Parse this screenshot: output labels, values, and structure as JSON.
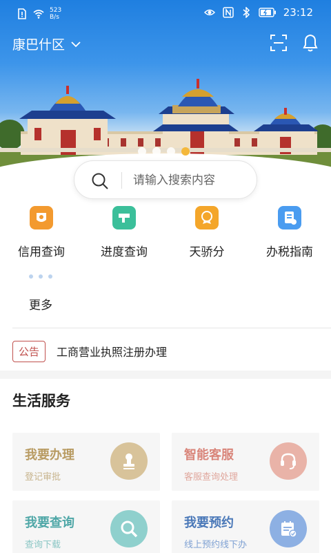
{
  "status_bar": {
    "network_speed_value": "523",
    "network_speed_unit": "B/s",
    "time": "23:12"
  },
  "header": {
    "district": "康巴什区"
  },
  "carousel": {
    "dot_count": 4,
    "active_index": 3
  },
  "search": {
    "placeholder": "请输入搜索内容"
  },
  "quick_services": [
    {
      "label": "信用查询",
      "icon": "credit-icon",
      "color": "#f39a2f"
    },
    {
      "label": "进度查询",
      "icon": "progress-icon",
      "color": "#3bbf9a"
    },
    {
      "label": "天骄分",
      "icon": "score-icon",
      "color": "#f4a62a"
    },
    {
      "label": "办税指南",
      "icon": "tax-guide-icon",
      "color": "#4a9cf0"
    }
  ],
  "more": {
    "label": "更多"
  },
  "notice": {
    "tag": "公告",
    "text": "工商营业执照注册办理"
  },
  "life_services": {
    "title": "生活服务",
    "cards": [
      {
        "title": "我要办理",
        "subtitle": "登记审批",
        "icon": "stamp-icon",
        "color": "#b89b62",
        "icon_bg": "#d8c39a"
      },
      {
        "title": "智能客服",
        "subtitle": "客服查询处理",
        "icon": "headset-icon",
        "color": "#d9857a",
        "icon_bg": "#e9b3a8"
      },
      {
        "title": "我要查询",
        "subtitle": "查询下载",
        "icon": "search-icon",
        "color": "#4fa7a7",
        "icon_bg": "#8fd0cd"
      },
      {
        "title": "我要预约",
        "subtitle": "线上预约线下办",
        "icon": "calendar-icon",
        "color": "#4a78b8",
        "icon_bg": "#8db0e3"
      }
    ]
  },
  "colors": {
    "accent_active_dot": "#f4b83b",
    "notice_red": "#c0504d"
  }
}
